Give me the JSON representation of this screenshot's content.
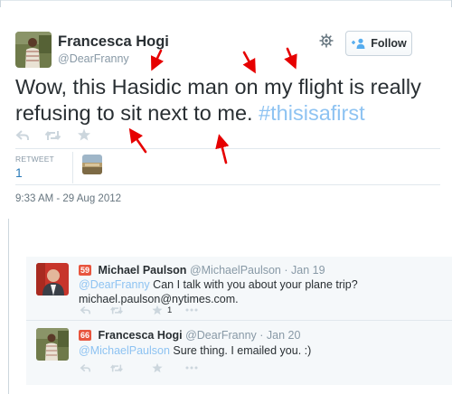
{
  "tweet": {
    "author_name": "Francesca Hogi",
    "author_handle": "@DearFranny",
    "follow_label": "Follow",
    "text_main": "Wow, this Hasidic man on my flight is really refusing to sit next to me.",
    "hashtag": "#thisisafirst",
    "retweets_label": "RETWEET",
    "retweets_count": "1",
    "timestamp": "9:33 AM - 29 Aug 2012"
  },
  "replies": [
    {
      "badge": "59",
      "name": "Michael Paulson",
      "handle": "@MichaelPaulson",
      "date": "· Jan 19",
      "mention": "@DearFranny",
      "text_rest": "Can I talk with you about your plane trip? michael.paulson@nytimes.com.",
      "favorites": "1"
    },
    {
      "badge": "66",
      "name": "Francesca Hogi",
      "handle": "@DearFranny",
      "date": "· Jan 20",
      "mention": "@MichaelPaulson",
      "text_rest": "Sure thing. I emailed you. :)"
    }
  ],
  "colors": {
    "accent": "#55acee",
    "hashtag": "#8ec3f2",
    "badge": "#e8553e",
    "annotation_arrow": "#e60000"
  },
  "icons": [
    "reply-icon",
    "retweet-icon",
    "favorite-icon",
    "more-icon",
    "gear-icon",
    "follow-person-icon"
  ]
}
